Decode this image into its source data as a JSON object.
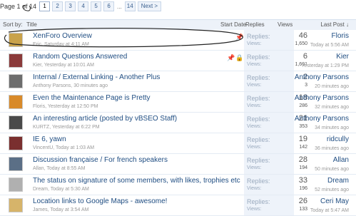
{
  "pagination": {
    "label": "Page 1 of 14",
    "pages": [
      "1",
      "2",
      "3",
      "4",
      "5",
      "6"
    ],
    "ellipsis": "...",
    "last": "14",
    "next": "Next >"
  },
  "header": {
    "sort_by": "Sort by:",
    "title": "Title",
    "start_date": "Start Date",
    "replies": "Replies",
    "views": "Views",
    "last_post": "Last Post ↓"
  },
  "labels": {
    "replies": "Replies:",
    "views": "Views:"
  },
  "threads": [
    {
      "title": "XenForo Overview",
      "meta": "Eric, Saturday at 4:11 AM",
      "replies": "46",
      "views": "1,650",
      "last_user": "Floris",
      "last_time": "Today at 5:56 AM",
      "avatar_color": "#c9a24a"
    },
    {
      "title": "Random Questions Answered",
      "meta": "Kier, Yesterday at 10:01 AM",
      "replies": "6",
      "views": "1,691",
      "last_user": "Kier",
      "last_time": "Yesterday at 1:29 PM",
      "avatar_color": "#8b3a3a"
    },
    {
      "title": "Internal / External Linking - Another Plus",
      "meta": "Anthony Parsons, 30 minutes ago",
      "replies": "2",
      "views": "3",
      "last_user": "Anthony Parsons",
      "last_time": "20 minutes ago",
      "avatar_color": "#6d6d6d"
    },
    {
      "title": "Even the Maintenance Page is Pretty",
      "meta": "Floris, Yesterday at 12:50 PM",
      "replies": "18",
      "views": "286",
      "last_user": "Anthony Parsons",
      "last_time": "32 minutes ago",
      "avatar_color": "#d88a2a"
    },
    {
      "title": "An interesting article (posted by vBSEO Staff)",
      "meta": "KURTZ, Yesterday at 6:22 PM",
      "replies": "21",
      "views": "353",
      "last_user": "Anthony Parsons",
      "last_time": "34 minutes ago",
      "avatar_color": "#4a4a4a"
    },
    {
      "title": "IE 6, yawn",
      "meta": "VincentU, Today at 1:03 AM",
      "replies": "19",
      "views": "142",
      "last_user": "ridcully",
      "last_time": "36 minutes ago",
      "avatar_color": "#7a2f2f"
    },
    {
      "title": "Discussion française / For french speakers",
      "meta": "Allan, Today at 8:55 AM",
      "replies": "28",
      "views": "194",
      "last_user": "Allan",
      "last_time": "50 minutes ago",
      "avatar_color": "#5b6f86"
    },
    {
      "title": "The status on signature of some members, with likes, trophies etc",
      "meta": "Dream, Today at 5:30 AM",
      "replies": "33",
      "views": "196",
      "last_user": "Dream",
      "last_time": "52 minutes ago",
      "avatar_color": "#b0b0b0"
    },
    {
      "title": "Location links to Google Maps - awesome!",
      "meta": "James, Today at 3:54 AM",
      "replies": "26",
      "views": "133",
      "last_user": "Ceri May",
      "last_time": "Today at 5:47 AM",
      "avatar_color": "#d6b46a"
    }
  ]
}
